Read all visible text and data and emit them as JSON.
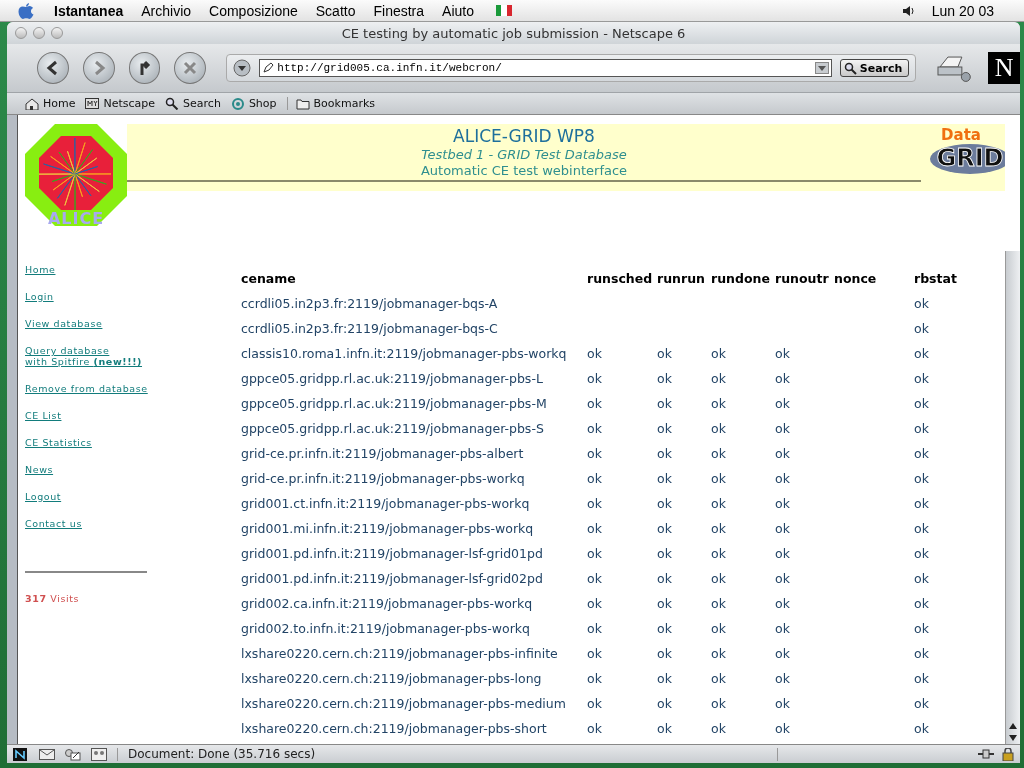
{
  "menu_bar": {
    "app": "Istantanea",
    "items": [
      "Archivio",
      "Composizione",
      "Scatto",
      "Finestra",
      "Aiuto"
    ],
    "clock": "Lun 20 03"
  },
  "window": {
    "title": "CE testing by automatic job submission - Netscape 6"
  },
  "toolbar": {
    "url": "http://grid005.ca.infn.it/webcron/",
    "search_button": "Search",
    "logo": "N"
  },
  "personal_bar": [
    {
      "kind": "home",
      "label": "Home"
    },
    {
      "kind": "my",
      "label": "Netscape"
    },
    {
      "kind": "search",
      "label": "Search"
    },
    {
      "kind": "shop",
      "label": "Shop"
    },
    {
      "kind": "folder",
      "label": "Bookmarks"
    }
  ],
  "header": {
    "alice_logo": "ALICE",
    "title": "ALICE-GRID WP8",
    "subtitle": "Testbed 1 - GRID Test Database",
    "tagline": "Automatic CE test webinterface",
    "datagrid_logo": {
      "top": "Data",
      "bottom": "GRID"
    }
  },
  "sidebar": {
    "links": [
      {
        "text": "Home"
      },
      {
        "text": "Login"
      },
      {
        "text": "View database"
      },
      {
        "text": "Query database\nwith Spitfire **(new!!!)**"
      },
      {
        "text": "Remove from database"
      },
      {
        "text": "CE List"
      },
      {
        "text": "CE Statistics"
      },
      {
        "text": "News"
      },
      {
        "text": "Logout"
      },
      {
        "text": "Contact us"
      }
    ],
    "visits": "**317** Visits"
  },
  "table": {
    "columns": [
      "cename",
      "runsched",
      "runrun",
      "rundone",
      "runoutr",
      "nonce",
      "rbstat"
    ],
    "rows": [
      [
        "ccrdli05.in2p3.fr:2119/jobmanager-bqs-A",
        null,
        null,
        null,
        null,
        null,
        "ok"
      ],
      [
        "ccrdli05.in2p3.fr:2119/jobmanager-bqs-C",
        null,
        null,
        null,
        null,
        null,
        "ok"
      ],
      [
        "classis10.roma1.infn.it:2119/jobmanager-pbs-workq",
        "ok",
        "ok",
        "ok",
        "ok",
        null,
        "ok"
      ],
      [
        "gppce05.gridpp.rl.ac.uk:2119/jobmanager-pbs-L",
        "ok",
        "ok",
        "ok",
        "ok",
        null,
        "ok"
      ],
      [
        "gppce05.gridpp.rl.ac.uk:2119/jobmanager-pbs-M",
        "ok",
        "ok",
        "ok",
        "ok",
        null,
        "ok"
      ],
      [
        "gppce05.gridpp.rl.ac.uk:2119/jobmanager-pbs-S",
        "ok",
        "ok",
        "ok",
        "ok",
        null,
        "ok"
      ],
      [
        "grid-ce.pr.infn.it:2119/jobmanager-pbs-albert",
        "ok",
        "ok",
        "ok",
        "ok",
        null,
        "ok"
      ],
      [
        "grid-ce.pr.infn.it:2119/jobmanager-pbs-workq",
        "ok",
        "ok",
        "ok",
        "ok",
        null,
        "ok"
      ],
      [
        "grid001.ct.infn.it:2119/jobmanager-pbs-workq",
        "ok",
        "ok",
        "ok",
        "ok",
        null,
        "ok"
      ],
      [
        "grid001.mi.infn.it:2119/jobmanager-pbs-workq",
        "ok",
        "ok",
        "ok",
        "ok",
        null,
        "ok"
      ],
      [
        "grid001.pd.infn.it:2119/jobmanager-lsf-grid01pd",
        "ok",
        "ok",
        "ok",
        "ok",
        null,
        "ok"
      ],
      [
        "grid001.pd.infn.it:2119/jobmanager-lsf-grid02pd",
        "ok",
        "ok",
        "ok",
        "ok",
        null,
        "ok"
      ],
      [
        "grid002.ca.infn.it:2119/jobmanager-pbs-workq",
        "ok",
        "ok",
        "ok",
        "ok",
        null,
        "ok"
      ],
      [
        "grid002.to.infn.it:2119/jobmanager-pbs-workq",
        "ok",
        "ok",
        "ok",
        "ok",
        null,
        "ok"
      ],
      [
        "lxshare0220.cern.ch:2119/jobmanager-pbs-infinite",
        "ok",
        "ok",
        "ok",
        "ok",
        null,
        "ok"
      ],
      [
        "lxshare0220.cern.ch:2119/jobmanager-pbs-long",
        "ok",
        "ok",
        "ok",
        "ok",
        null,
        "ok"
      ],
      [
        "lxshare0220.cern.ch:2119/jobmanager-pbs-medium",
        "ok",
        "ok",
        "ok",
        "ok",
        null,
        "ok"
      ],
      [
        "lxshare0220.cern.ch:2119/jobmanager-pbs-short",
        "ok",
        "ok",
        "ok",
        "ok",
        null,
        "ok"
      ]
    ]
  },
  "status_bar": {
    "text": "Document: Done (35.716 secs)"
  }
}
